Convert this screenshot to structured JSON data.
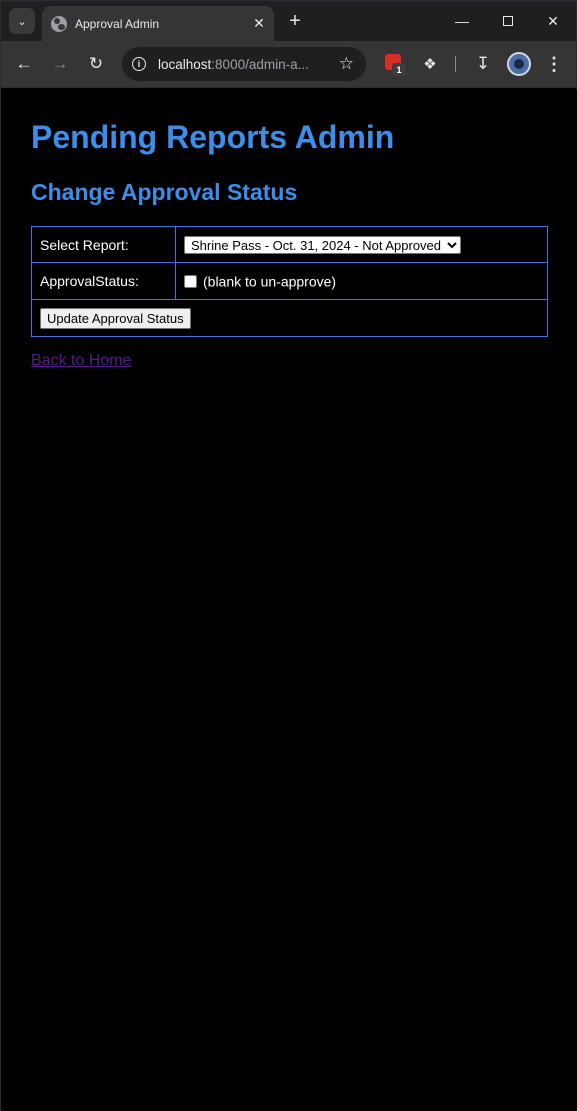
{
  "browser": {
    "tab_title": "Approval Admin",
    "url_host": "localhost",
    "url_rest": ":8000/admin-a...",
    "extension_badge": "1"
  },
  "page": {
    "title": "Pending Reports Admin",
    "subtitle": "Change Approval Status",
    "form": {
      "report_label": "Select Report:",
      "report_selected": "Shrine Pass - Oct. 31, 2024 - Not Approved",
      "approval_label": "ApprovalStatus:",
      "approval_hint": "(blank to un-approve)",
      "approval_checked": false,
      "submit_label": "Update Approval Status"
    },
    "back_link": "Back to Home"
  },
  "colors": {
    "heading": "#3d8ee8",
    "table_border": "#4a6fe0",
    "visited_link": "#551a8b",
    "background": "#000000"
  }
}
